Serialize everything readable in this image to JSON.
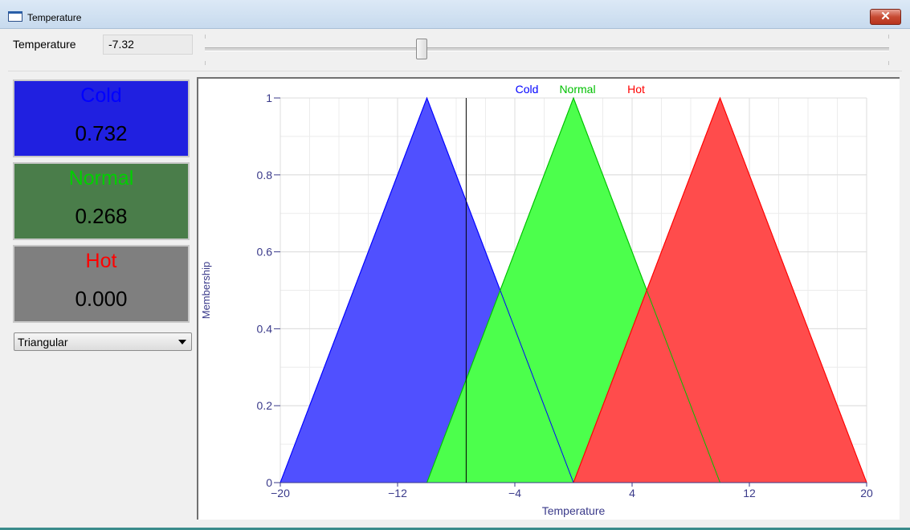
{
  "window": {
    "title": "Temperature",
    "close_label": "✕",
    "app_icon": "window-icon"
  },
  "input": {
    "label": "Temperature",
    "value": "-7.32",
    "slider_min": -20,
    "slider_max": 20,
    "slider_value": -7.32
  },
  "memberships": [
    {
      "name": "Cold",
      "value": "0.732",
      "name_color": "#0000ff",
      "bg": "#2020e0"
    },
    {
      "name": "Normal",
      "value": "0.268",
      "name_color": "#00d000",
      "bg": "#4a7d4a"
    },
    {
      "name": "Hot",
      "value": "0.000",
      "name_color": "#ff0000",
      "bg": "#7f7f7f"
    }
  ],
  "shape_select": {
    "selected": "Triangular"
  },
  "chart_data": {
    "type": "area",
    "title": "",
    "xlabel": "Temperature",
    "ylabel": "Membership",
    "xlim": [
      -20,
      20
    ],
    "ylim": [
      0,
      1
    ],
    "x_ticks": [
      "−20",
      "−12",
      "−4",
      "4",
      "12",
      "20"
    ],
    "x_tick_values": [
      -20,
      -12,
      -4,
      4,
      12,
      20
    ],
    "y_ticks": [
      "0",
      "0.2",
      "0.4",
      "0.6",
      "0.8",
      "1"
    ],
    "y_tick_values": [
      0,
      0.2,
      0.4,
      0.6,
      0.8,
      1
    ],
    "grid": true,
    "legend": "top-center",
    "cursor_x": -7.32,
    "series": [
      {
        "name": "Cold",
        "color": "#0000ff",
        "fill": "#5050ff",
        "points": [
          [
            -20,
            0
          ],
          [
            -10,
            1
          ],
          [
            0,
            0
          ]
        ]
      },
      {
        "name": "Normal",
        "color": "#00c000",
        "fill": "#4cff4c",
        "points": [
          [
            -10,
            0
          ],
          [
            0,
            1
          ],
          [
            10,
            0
          ]
        ]
      },
      {
        "name": "Hot",
        "color": "#ff0000",
        "fill": "#ff4c4c",
        "points": [
          [
            0,
            0
          ],
          [
            10,
            1
          ],
          [
            20,
            0
          ]
        ]
      }
    ]
  }
}
